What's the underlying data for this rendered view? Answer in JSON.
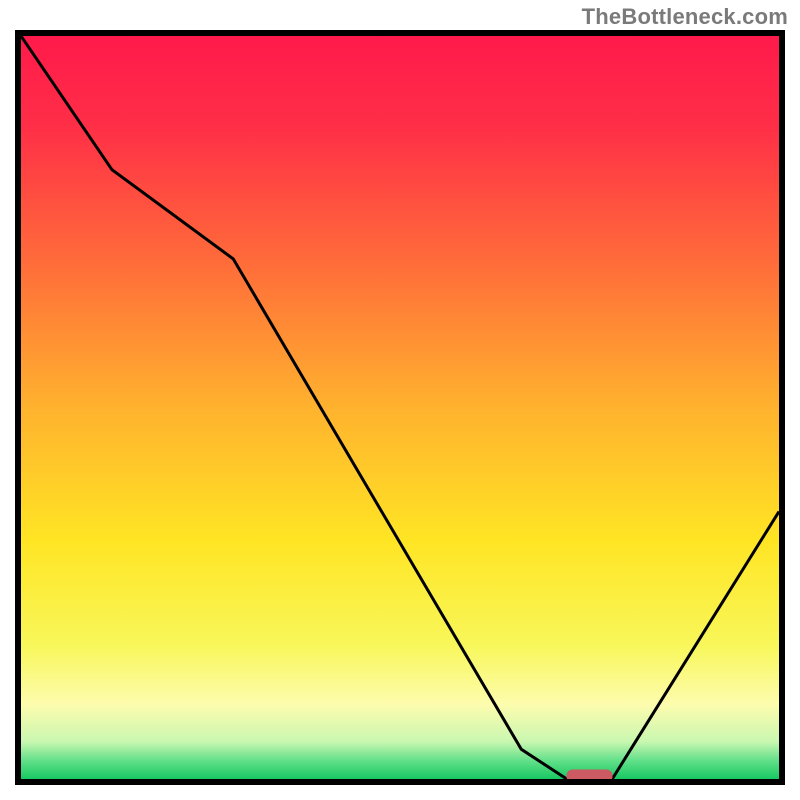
{
  "watermark": "TheBottleneck.com",
  "chart_data": {
    "type": "line",
    "title": "",
    "xlabel": "",
    "ylabel": "",
    "xlim": [
      0,
      100
    ],
    "ylim": [
      0,
      100
    ],
    "grid": false,
    "legend": false,
    "series": [
      {
        "name": "curve",
        "x": [
          0,
          12,
          28,
          66,
          72,
          78,
          100
        ],
        "y": [
          100,
          82,
          70,
          4,
          0,
          0,
          36
        ]
      }
    ],
    "gradient_stops": [
      {
        "offset": 0.0,
        "color": "#ff1a4b"
      },
      {
        "offset": 0.12,
        "color": "#ff2e47"
      },
      {
        "offset": 0.3,
        "color": "#ff6a3a"
      },
      {
        "offset": 0.5,
        "color": "#ffb22e"
      },
      {
        "offset": 0.68,
        "color": "#ffe524"
      },
      {
        "offset": 0.82,
        "color": "#f8f75a"
      },
      {
        "offset": 0.9,
        "color": "#fdfcae"
      },
      {
        "offset": 0.95,
        "color": "#c9f7b0"
      },
      {
        "offset": 0.975,
        "color": "#63e08a"
      },
      {
        "offset": 1.0,
        "color": "#18c862"
      }
    ],
    "marker": {
      "x": 75,
      "y": 0,
      "color": "#cc5a63",
      "shape": "pill"
    }
  }
}
